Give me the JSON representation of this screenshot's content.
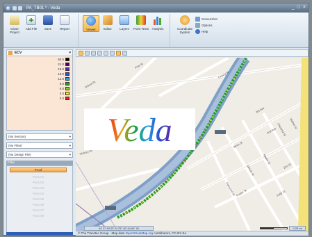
{
  "window": {
    "title": "PA_TB01 * - Veda",
    "controls": [
      "_",
      "□",
      "×"
    ]
  },
  "ribbon": {
    "close_project": "Close Project",
    "add_file": "Add File",
    "save": "Save",
    "report": "Report",
    "viewer": "Viewer",
    "editor": "Editor",
    "layers": "Layers",
    "point_texts": "Point Texts",
    "analysis": "Analysis",
    "coordinate_system": "Coordinate System",
    "screenshot": "Screenshot",
    "options": "Options",
    "help": "Help"
  },
  "layer": {
    "name": "ECV"
  },
  "legend": [
    {
      "label": "60.0",
      "color": "#000000"
    },
    {
      "label": "21.0",
      "color": "#3a0066"
    },
    {
      "label": "18.0",
      "color": "#5b2aa6"
    },
    {
      "label": "15.0",
      "color": "#2d4fd1"
    },
    {
      "label": "12.0",
      "color": "#21a3e3"
    },
    {
      "label": "9.0",
      "color": "#1e9f2b"
    },
    {
      "label": "6.0",
      "color": "#84d11f"
    },
    {
      "label": "3.0",
      "color": "#f3e12a"
    },
    {
      "label": "0.0",
      "color": "#e3221a"
    }
  ],
  "filters": {
    "section": "(No Section)",
    "filter": "(No Filter)",
    "design": "(No Design File)",
    "header": "Filter",
    "proof": "Proof",
    "passes": [
      "Pass 01",
      "Pass 02",
      "Pass 03",
      "Pass 04",
      "Pass 05",
      "Pass 06",
      "Pass 07",
      "Pass 08"
    ]
  },
  "map": {
    "coordinates": "40 27 45.23\" N 79° 49' 44.04\" W",
    "zoom": "0.25 mi",
    "streets": [
      "Oxford St",
      "Pine St",
      "Cherry St",
      "3rd Ave",
      "2nd Ave",
      "Birch St",
      "Elm St",
      "Spruce St",
      "Maple St",
      "Poplar St",
      "Holly St",
      "Oakwood St",
      "Chestnut St",
      "Walnut St",
      "Hickory Dr"
    ],
    "route": "US 219",
    "route2": "US 219"
  },
  "logo": {
    "text": "Veda"
  },
  "status": {
    "attribution_prefix": "© The Transtec Group - Map data ",
    "attribution_link": "OpenStreetMap.org",
    "attribution_suffix": " contributors, CC-BY-SA"
  },
  "colors": {
    "highway": "#7f9fc7",
    "accent": "#f6b64a"
  }
}
